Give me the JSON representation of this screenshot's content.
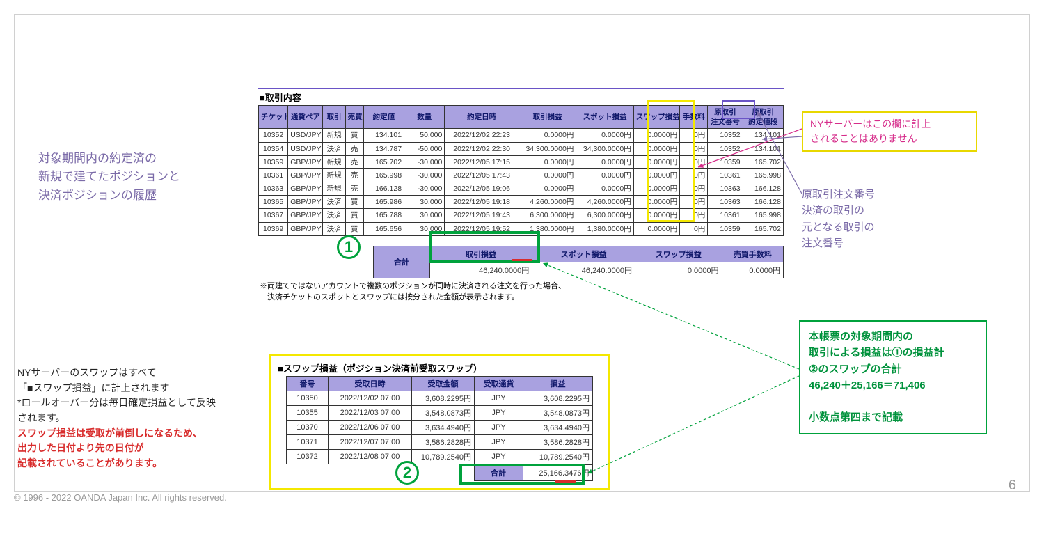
{
  "page_number": "6",
  "copyright": "© 1996 - 2022 OANDA Japan Inc. All rights reserved.",
  "left_purple_note": {
    "l1": "対象期間内の約定済の",
    "l2": "新規で建てたポジションと",
    "l3": "決済ポジションの履歴"
  },
  "left_block": {
    "l1": "NYサーバーのスワップはすべて",
    "l2": "「■スワップ損益」に計上されます",
    "l3": "*ロールオーバー分は毎日確定損益として反映",
    "l4": "されます。",
    "l5": "スワップ損益は受取が前倒しになるため、",
    "l6": "出力した日付より先の日付が",
    "l7": "記載されていることがあります。"
  },
  "callout_yellow": {
    "l1": "NYサーバーはこの欄に計上",
    "l2": "されることはありません"
  },
  "callout_purple": {
    "l1": "原取引注文番号",
    "l2": "決済の取引の",
    "l3": "元となる取引の",
    "l4": "注文番号"
  },
  "callout_green": {
    "l1": "本帳票の対象期間内の",
    "l2": "取引による損益は①の損益計",
    "l3": "②のスワップの合計",
    "l4": "46,240＋25,166＝71,406",
    "l5": "小数点第四まで記載"
  },
  "section1_title": "■取引内容",
  "section2_title": "■スワップ損益（ポジション決済前受取スワップ）",
  "cols1": {
    "c0": "チケット番号",
    "c1": "通貨ペア",
    "c2": "取引",
    "c3": "売買",
    "c4": "約定値",
    "c5": "数量",
    "c6": "約定日時",
    "c7": "取引損益",
    "c8": "スポット損益",
    "c9": "スワップ損益",
    "c10": "手数料",
    "c11": "原取引\n注文番号",
    "c12": "原取引\n約定値段"
  },
  "rows1": [
    {
      "c0": "10352",
      "c1": "USD/JPY",
      "c2": "新規",
      "c3": "買",
      "c4": "134.101",
      "c5": "50,000",
      "c6": "2022/12/02 22:23",
      "c7": "0.0000円",
      "c8": "0.0000円",
      "c9": "0.0000円",
      "c10": "0円",
      "c11": "10352",
      "c12": "134.101"
    },
    {
      "c0": "10354",
      "c1": "USD/JPY",
      "c2": "決済",
      "c3": "売",
      "c4": "134.787",
      "c5": "-50,000",
      "c6": "2022/12/02 22:30",
      "c7": "34,300.0000円",
      "c8": "34,300.0000円",
      "c9": "0.0000円",
      "c10": "0円",
      "c11": "10352",
      "c12": "134.101"
    },
    {
      "c0": "10359",
      "c1": "GBP/JPY",
      "c2": "新規",
      "c3": "売",
      "c4": "165.702",
      "c5": "-30,000",
      "c6": "2022/12/05 17:15",
      "c7": "0.0000円",
      "c8": "0.0000円",
      "c9": "0.0000円",
      "c10": "0円",
      "c11": "10359",
      "c12": "165.702"
    },
    {
      "c0": "10361",
      "c1": "GBP/JPY",
      "c2": "新規",
      "c3": "売",
      "c4": "165.998",
      "c5": "-30,000",
      "c6": "2022/12/05 17:43",
      "c7": "0.0000円",
      "c8": "0.0000円",
      "c9": "0.0000円",
      "c10": "0円",
      "c11": "10361",
      "c12": "165.998"
    },
    {
      "c0": "10363",
      "c1": "GBP/JPY",
      "c2": "新規",
      "c3": "売",
      "c4": "166.128",
      "c5": "-30,000",
      "c6": "2022/12/05 19:06",
      "c7": "0.0000円",
      "c8": "0.0000円",
      "c9": "0.0000円",
      "c10": "0円",
      "c11": "10363",
      "c12": "166.128"
    },
    {
      "c0": "10365",
      "c1": "GBP/JPY",
      "c2": "決済",
      "c3": "買",
      "c4": "165.986",
      "c5": "30,000",
      "c6": "2022/12/05 19:18",
      "c7": "4,260.0000円",
      "c8": "4,260.0000円",
      "c9": "0.0000円",
      "c10": "0円",
      "c11": "10363",
      "c12": "166.128"
    },
    {
      "c0": "10367",
      "c1": "GBP/JPY",
      "c2": "決済",
      "c3": "買",
      "c4": "165.788",
      "c5": "30,000",
      "c6": "2022/12/05 19:43",
      "c7": "6,300.0000円",
      "c8": "6,300.0000円",
      "c9": "0.0000円",
      "c10": "0円",
      "c11": "10361",
      "c12": "165.998"
    },
    {
      "c0": "10369",
      "c1": "GBP/JPY",
      "c2": "決済",
      "c3": "買",
      "c4": "165.656",
      "c5": "30,000",
      "c6": "2022/12/05 19:52",
      "c7": "1,380.0000円",
      "c8": "1,380.0000円",
      "c9": "0.0000円",
      "c10": "0円",
      "c11": "10359",
      "c12": "165.702"
    }
  ],
  "sum": {
    "goukei": "合計",
    "h1": "取引損益",
    "h2": "スポット損益",
    "h3": "スワップ損益",
    "h4": "売買手数料",
    "v1": "46,240.0000円",
    "v2": "46,240.0000円",
    "v3": "0.0000円",
    "v4": "0.0000円"
  },
  "footnote": {
    "l1": "※両建てではないアカウントで複数のポジションが同時に決済される注文を行った場合、",
    "l2": "　決済チケットのスポットとスワップには按分された金額が表示されます。"
  },
  "cols2": {
    "c0": "番号",
    "c1": "受取日時",
    "c2": "受取金額",
    "c3": "受取通貨",
    "c4": "損益"
  },
  "rows2": [
    {
      "c0": "10350",
      "c1": "2022/12/02 07:00",
      "c2": "3,608.2295円",
      "c3": "JPY",
      "c4": "3,608.2295円"
    },
    {
      "c0": "10355",
      "c1": "2022/12/03 07:00",
      "c2": "3,548.0873円",
      "c3": "JPY",
      "c4": "3,548.0873円"
    },
    {
      "c0": "10370",
      "c1": "2022/12/06 07:00",
      "c2": "3,634.4940円",
      "c3": "JPY",
      "c4": "3,634.4940円"
    },
    {
      "c0": "10371",
      "c1": "2022/12/07 07:00",
      "c2": "3,586.2828円",
      "c3": "JPY",
      "c4": "3,586.2828円"
    },
    {
      "c0": "10372",
      "c1": "2022/12/08 07:00",
      "c2": "10,789.2540円",
      "c3": "JPY",
      "c4": "10,789.2540円"
    }
  ],
  "swap_total": {
    "label": "合計",
    "val": "25,166.3476円"
  },
  "circ": {
    "one": "1",
    "two": "2"
  }
}
